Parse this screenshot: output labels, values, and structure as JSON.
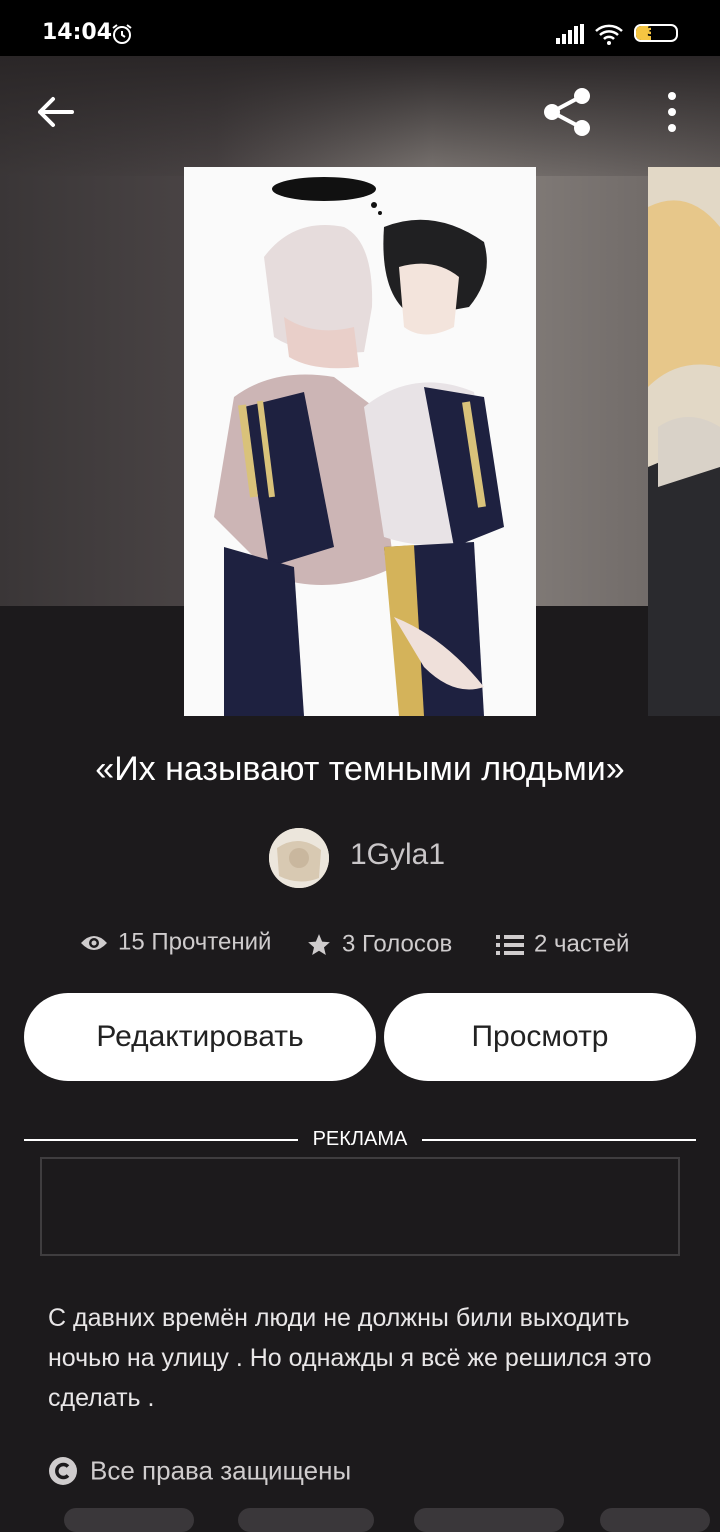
{
  "status_bar": {
    "time": "14:04",
    "battery": "37",
    "battery_level": 0.37
  },
  "story": {
    "title": "«Их называют темными людьми»",
    "author": "1Gyla1",
    "stats": {
      "reads": "15 Прочтений",
      "votes": "3 Голосов",
      "parts": "2 частей"
    },
    "description": "С давних времён люди не должны били выходить ночью на улицу . Но однажды я всё же решился это сделать .",
    "rights": "Все права защищены"
  },
  "buttons": {
    "edit": "Редактировать",
    "view": "Просмотр"
  },
  "ad": {
    "label": "РЕКЛАМА"
  },
  "icons": {
    "back": "arrow-back-icon",
    "share": "share-icon",
    "more": "more-vert-icon",
    "views": "eye-icon",
    "votes": "star-icon",
    "parts": "list-icon",
    "copyright": "copyright-icon"
  }
}
